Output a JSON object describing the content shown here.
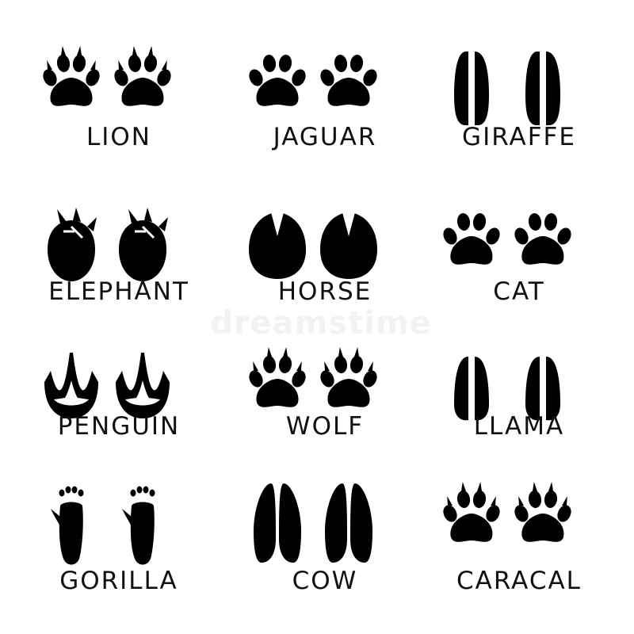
{
  "animals": [
    {
      "name": "LION",
      "icon": "lion-paw-icon",
      "type": "paw-claw"
    },
    {
      "name": "JAGUAR",
      "icon": "jaguar-paw-icon",
      "type": "paw"
    },
    {
      "name": "GIRAFFE",
      "icon": "giraffe-hoof-icon",
      "type": "giraffe"
    },
    {
      "name": "ELEPHANT",
      "icon": "elephant-foot-icon",
      "type": "elephant"
    },
    {
      "name": "HORSE",
      "icon": "horse-hoof-icon",
      "type": "horse"
    },
    {
      "name": "CAT",
      "icon": "cat-paw-icon",
      "type": "paw"
    },
    {
      "name": "PENGUIN",
      "icon": "penguin-foot-icon",
      "type": "penguin"
    },
    {
      "name": "WOLF",
      "icon": "wolf-paw-icon",
      "type": "paw-claw"
    },
    {
      "name": "LLAMA",
      "icon": "llama-foot-icon",
      "type": "llama"
    },
    {
      "name": "GORILLA",
      "icon": "gorilla-foot-icon",
      "type": "gorilla"
    },
    {
      "name": "COW",
      "icon": "cow-hoof-icon",
      "type": "cow"
    },
    {
      "name": "CARACAL",
      "icon": "caracal-paw-icon",
      "type": "paw-claw"
    }
  ],
  "watermark": "dreamstime",
  "colors": {
    "ink": "#000000",
    "text": "#111111",
    "background": "#ffffff"
  }
}
